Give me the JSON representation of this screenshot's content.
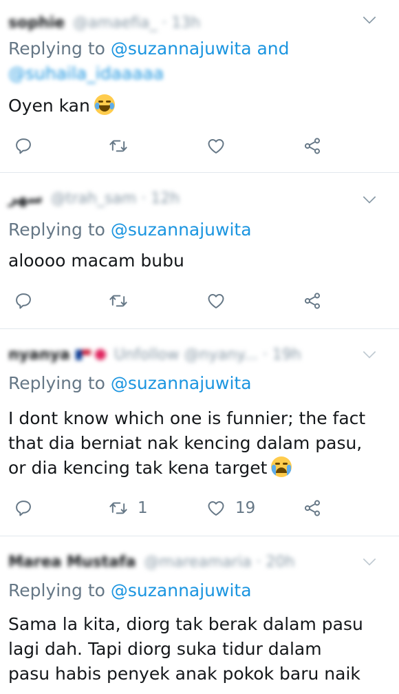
{
  "tweets": [
    {
      "name": "sophie",
      "handle": "@amaefia_ · 13h",
      "replying_prefix": "Replying to",
      "replying_to": "@suzannajuwita and",
      "replying_to_2": "@suhaila_idaaaaa",
      "text": "Oyen kan",
      "emoji": "face-with-tears-of-joy",
      "retweets": "",
      "likes": ""
    },
    {
      "name": "سهر",
      "handle": "@trah_sam · 12h",
      "replying_prefix": "Replying to",
      "replying_to": "@suzannajuwita",
      "text": "aloooo macam bubu",
      "retweets": "",
      "likes": ""
    },
    {
      "name": "nyanya",
      "handle": "Unfollow @nyany... · 19h",
      "replying_prefix": "Replying to",
      "replying_to": "@suzannajuwita",
      "text_lines": [
        "I dont know which one is funnier; the fact",
        "that dia berniat nak kencing dalam pasu,",
        "or dia kencing tak kena target"
      ],
      "emoji": "loudly-crying-face",
      "retweets": "1",
      "likes": "19"
    },
    {
      "name": "Marea Mustafa",
      "handle": "@mareamaria · 20h",
      "replying_prefix": "Replying to",
      "replying_to": "@suzannajuwita",
      "text_lines": [
        "Sama la kita, diorg tak berak dalam pasu",
        "lagi dah. Tapi diorg suka tidur dalam",
        "pasu habis penyek anak pokok baru naik"
      ]
    }
  ],
  "colors": {
    "accent": "#1b95e0",
    "secondary_text": "#657786",
    "icon": "#657786",
    "divider": "#e1e8ed"
  },
  "icons": [
    "reply-icon",
    "retweet-icon",
    "like-icon",
    "share-icon",
    "chevron-down-icon"
  ]
}
